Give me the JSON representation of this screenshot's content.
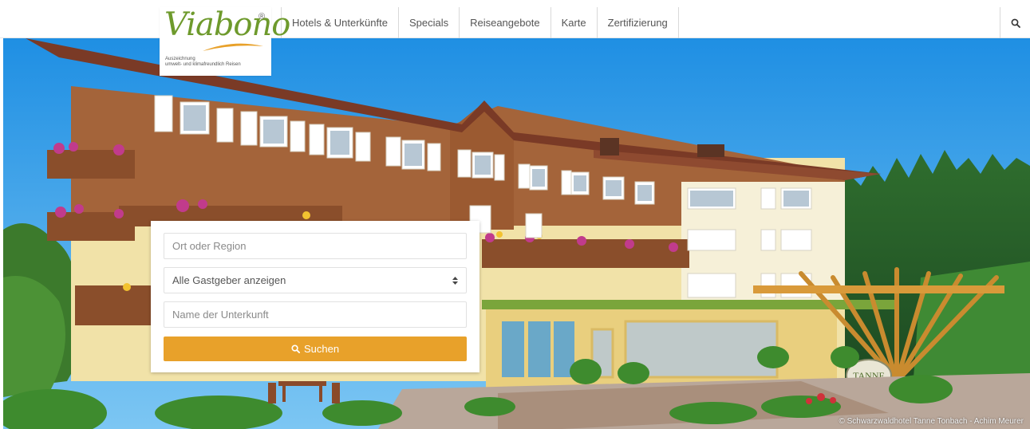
{
  "brand": {
    "logo_text": "Viabono",
    "logo_mark": "®",
    "tagline_line1": "Auszeichnung",
    "tagline_line2": "umwelt- und klimafreundlich Reisen",
    "logo_color": "#6e9a2c",
    "swoosh_color": "#e8a12a"
  },
  "nav": {
    "items": [
      {
        "label": "Hotels & Unterkünfte"
      },
      {
        "label": "Specials"
      },
      {
        "label": "Reiseangebote"
      },
      {
        "label": "Karte"
      },
      {
        "label": "Zertifizierung"
      }
    ],
    "search_icon": "search-icon"
  },
  "search_form": {
    "location_placeholder": "Ort oder Region",
    "host_select_value": "Alle Gastgeber anzeigen",
    "name_placeholder": "Name der Unterkunft",
    "submit_label": "Suchen",
    "submit_icon": "search-icon",
    "accent_color": "#e8a12a"
  },
  "hero": {
    "sign_text": "TANNE",
    "photo_credit": "© Schwarzwaldhotel Tanne Tonbach - Achim Meurer"
  }
}
